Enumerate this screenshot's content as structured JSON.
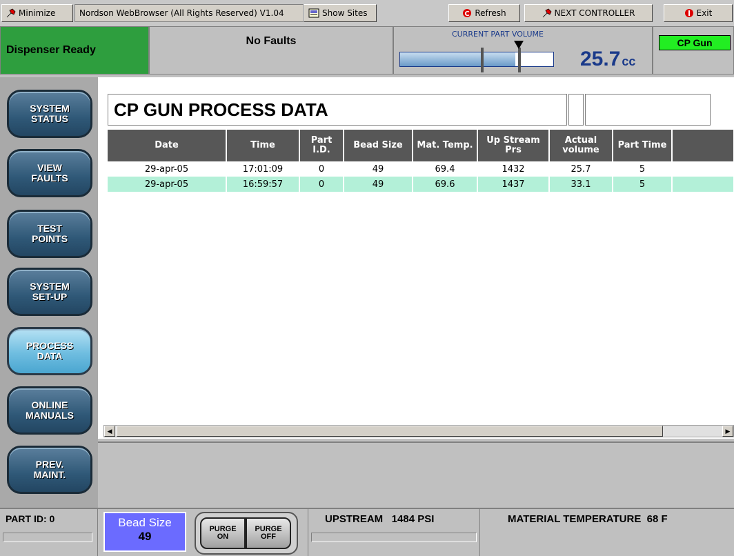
{
  "toolbar": {
    "minimize": "Minimize",
    "title": "Nordson WebBrowser (All Rights Reserved) V1.04",
    "show_sites": "Show Sites",
    "refresh": "Refresh",
    "next_controller": "NEXT CONTROLLER",
    "exit": "Exit"
  },
  "header": {
    "dispenser_status": "Dispenser Ready",
    "faults": "No Faults",
    "volume_label": "CURRENT PART VOLUME",
    "volume_value": "25.7",
    "volume_unit": "cc",
    "volume_fill": 0.75,
    "gun_name": "CP Gun"
  },
  "nav": [
    {
      "line1": "SYSTEM",
      "line2": "STATUS"
    },
    {
      "line1": "VIEW",
      "line2": "FAULTS"
    },
    {
      "line1": "TEST",
      "line2": "POINTS"
    },
    {
      "line1": "SYSTEM",
      "line2": "SET-UP"
    },
    {
      "line1": "PROCESS",
      "line2": "DATA"
    },
    {
      "line1": "ONLINE",
      "line2": "MANUALS"
    },
    {
      "line1": "PREV.",
      "line2": "MAINT."
    }
  ],
  "page_title": "CP GUN PROCESS DATA",
  "table": {
    "headers": [
      {
        "l1": "Date",
        "l2": ""
      },
      {
        "l1": "Time",
        "l2": ""
      },
      {
        "l1": "Part",
        "l2": "I.D."
      },
      {
        "l1": "Bead Size",
        "l2": ""
      },
      {
        "l1": "Mat. Temp.",
        "l2": ""
      },
      {
        "l1": "Up Stream",
        "l2": "Prs"
      },
      {
        "l1": "Actual",
        "l2": "volume"
      },
      {
        "l1": "Part Time",
        "l2": ""
      }
    ],
    "rows": [
      [
        "29-apr-05",
        "17:01:09",
        "0",
        "49",
        "69.4",
        "1432",
        "25.7",
        "5"
      ],
      [
        "29-apr-05",
        "16:59:57",
        "0",
        "49",
        "69.6",
        "1437",
        "33.1",
        "5"
      ]
    ]
  },
  "bottom": {
    "part_id": "PART ID: 0",
    "bead_size_label": "Bead Size",
    "bead_size_value": "49",
    "purge_on_l1": "PURGE",
    "purge_on_l2": "ON",
    "purge_off_l1": "PURGE",
    "purge_off_l2": "OFF",
    "upstream": "UPSTREAM   1484 PSI",
    "material_temp": "MATERIAL TEMPERATURE  68 F"
  },
  "colors": {
    "ready": "#2e9e3e",
    "gun": "#22ee22",
    "bead_box": "#6b6bff",
    "row_alt": "#b3f0d8",
    "volume_text": "#1a3a8a"
  }
}
